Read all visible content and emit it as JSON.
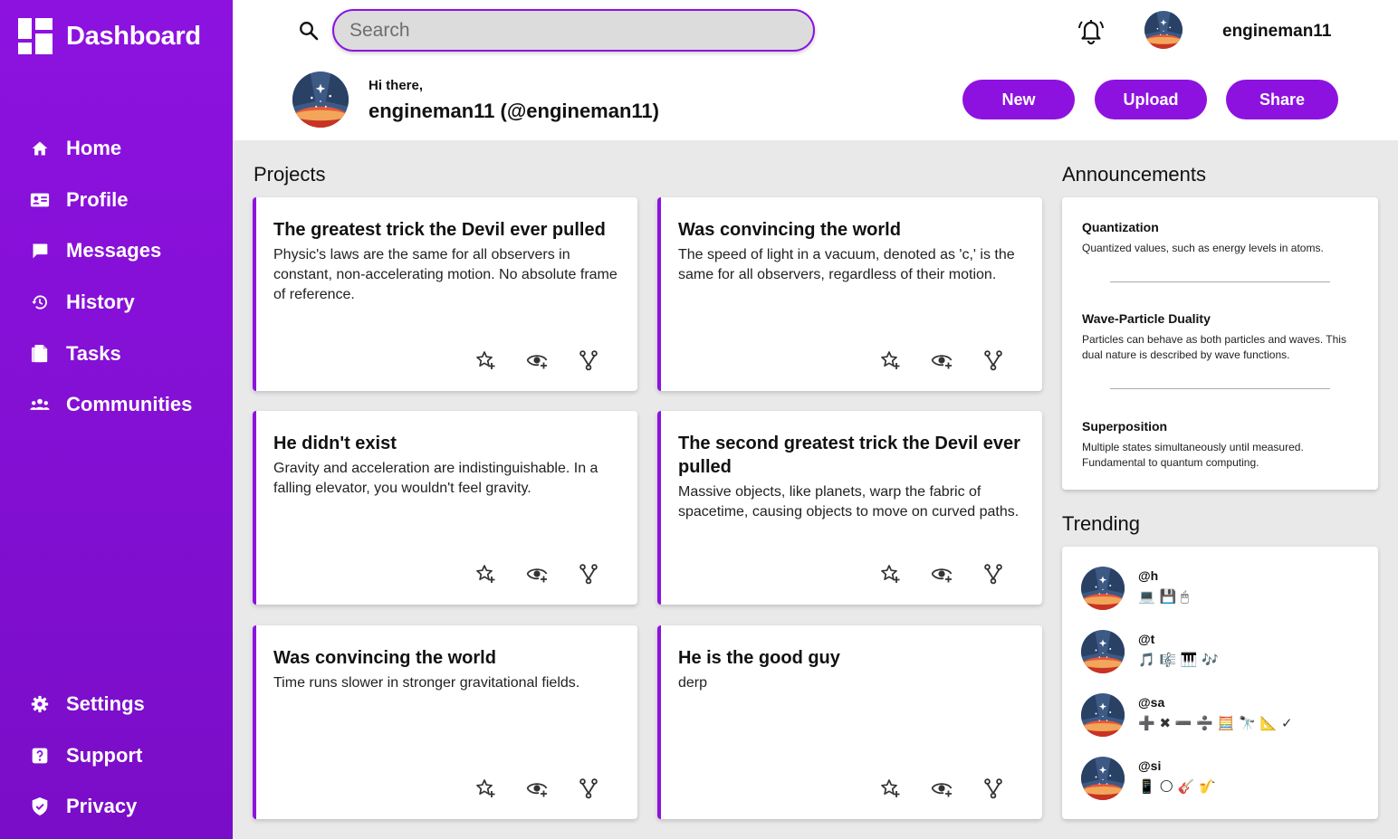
{
  "brand": {
    "title": "Dashboard"
  },
  "sidebar": {
    "items": [
      {
        "label": "Home",
        "icon": "home-icon"
      },
      {
        "label": "Profile",
        "icon": "id-card-icon"
      },
      {
        "label": "Messages",
        "icon": "chat-icon"
      },
      {
        "label": "History",
        "icon": "history-icon"
      },
      {
        "label": "Tasks",
        "icon": "document-icon"
      },
      {
        "label": "Communities",
        "icon": "group-icon"
      }
    ],
    "bottom_items": [
      {
        "label": "Settings",
        "icon": "gear-icon"
      },
      {
        "label": "Support",
        "icon": "help-icon"
      },
      {
        "label": "Privacy",
        "icon": "shield-icon"
      }
    ]
  },
  "header": {
    "search_placeholder": "Search",
    "username": "engineman11",
    "greeting": "Hi there,",
    "display_name": "engineman11 (@engineman11)",
    "buttons": {
      "new": "New",
      "upload": "Upload",
      "share": "Share"
    }
  },
  "projects": {
    "heading": "Projects",
    "cards": [
      {
        "title": "The greatest trick the Devil ever pulled",
        "description": "Physic's laws are the same for all observers in constant, non-accelerating motion. No absolute frame of reference."
      },
      {
        "title": "Was convincing the world",
        "description": "The speed of light in a vacuum, denoted as 'c,' is the same for all observers, regardless of their motion."
      },
      {
        "title": "He didn't exist",
        "description": "Gravity and acceleration are indistinguishable. In a falling elevator, you wouldn't feel gravity."
      },
      {
        "title": "The second greatest trick the Devil ever pulled",
        "description": "Massive objects, like planets, warp the fabric of spacetime, causing objects to move on curved paths."
      },
      {
        "title": "Was convincing the world",
        "description": "Time runs slower in stronger gravitational fields."
      },
      {
        "title": "He is the good guy",
        "description": "derp"
      }
    ]
  },
  "announcements": {
    "heading": "Announcements",
    "items": [
      {
        "title": "Quantization",
        "text": "Quantized values, such as energy levels in atoms."
      },
      {
        "title": "Wave-Particle Duality",
        "text": "Particles can behave as both particles and waves. This dual nature is described by wave functions."
      },
      {
        "title": "Superposition",
        "text": "Multiple states simultaneously until measured. Fundamental to quantum computing."
      }
    ]
  },
  "trending": {
    "heading": "Trending",
    "users": [
      {
        "handle": "@h",
        "emojis": "💻 💾 🖱"
      },
      {
        "handle": "@t",
        "emojis": "🎵 🎼 🎹 🎶"
      },
      {
        "handle": "@sa",
        "emojis": "➕ ✖ ➖ ➗ 🧮 🔭 📐 ✓"
      },
      {
        "handle": "@si",
        "emojis": "📱 🌕 🎸 🎷"
      }
    ]
  },
  "colors": {
    "accent": "#8d12e0",
    "background": "#e9e9e9",
    "card": "#ffffff"
  }
}
